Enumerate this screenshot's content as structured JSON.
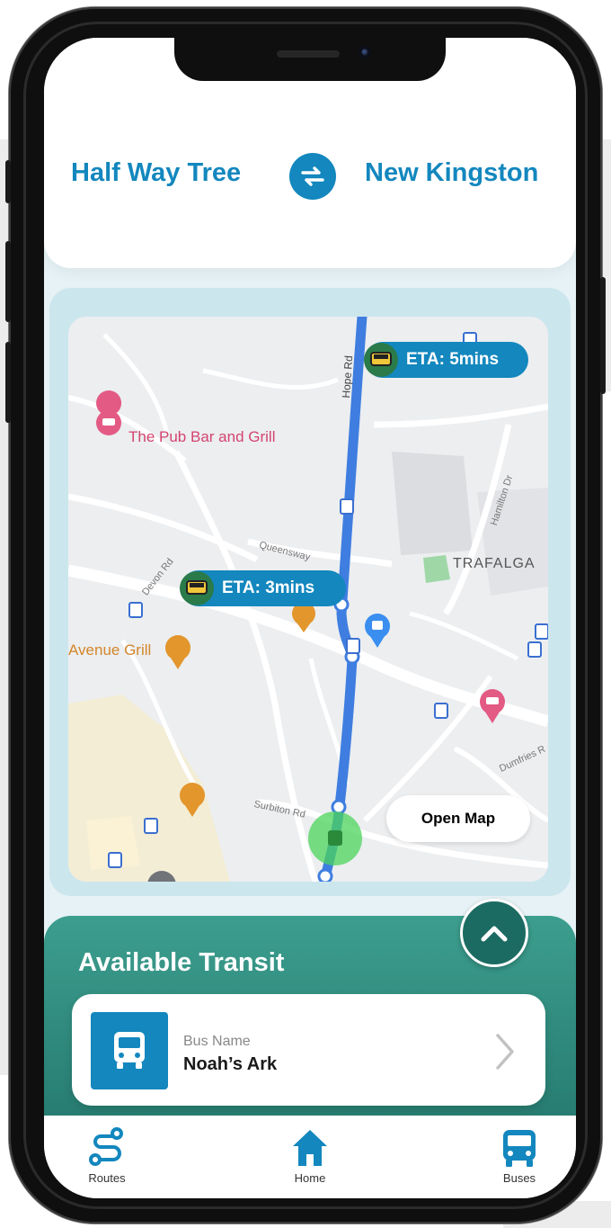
{
  "route": {
    "from": "Half Way Tree",
    "to": "New Kingston"
  },
  "map": {
    "places": {
      "pub": "The Pub Bar and Grill",
      "avenue_grill": "Avenue Grill",
      "trafalgar": "TRAFALGA"
    },
    "streets": {
      "hope_rd": "Hope Rd",
      "hamilton_dr": "Hamilton Dr",
      "queensway": "Queensway",
      "devon_rd": "Devon Rd",
      "surbiton_rd": "Surbiton Rd",
      "dumfries": "Dumfries R"
    },
    "eta_top": "ETA: 5mins",
    "eta_middle": "ETA: 3mins",
    "open_map_label": "Open Map"
  },
  "transit": {
    "title": "Available Transit",
    "bus_name_label": "Bus Name",
    "bus_name": "Noah’s Ark"
  },
  "tabs": [
    {
      "label": "Routes",
      "icon": "route-icon"
    },
    {
      "label": "Home",
      "icon": "home-icon"
    },
    {
      "label": "Buses",
      "icon": "bus-icon"
    }
  ],
  "colors": {
    "primary_blue": "#1387be",
    "transit_green": "#2e8b7e",
    "route_line": "#3f7ee0",
    "map_background": "#eceef0",
    "poi_pink": "#e35a84",
    "poi_orange": "#e3962c"
  }
}
